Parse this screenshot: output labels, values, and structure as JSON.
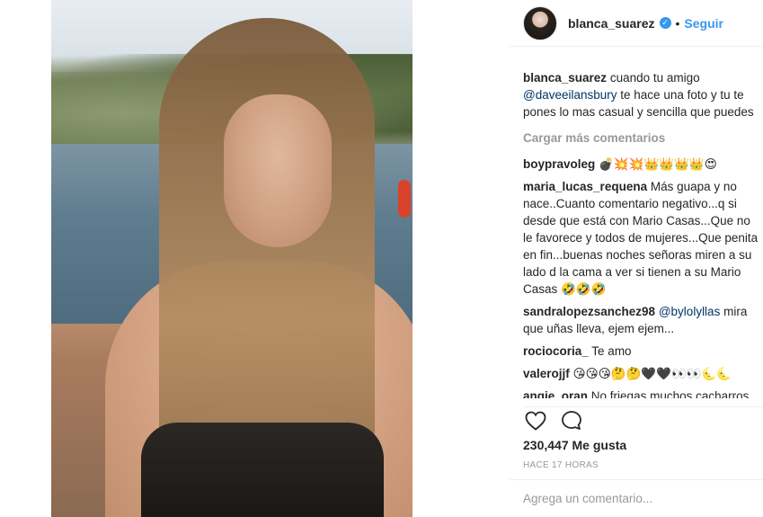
{
  "post": {
    "username": "blanca_suarez",
    "follow_label": "Seguir",
    "separator": "•",
    "verified_glyph": "✓"
  },
  "caption": {
    "username": "blanca_suarez",
    "text_before": "cuando tu amigo",
    "mention": "@daveeilansbury",
    "text_after": "te hace una foto y tu te pones lo mas casual y sencilla que puedes"
  },
  "load_more_label": "Cargar más comentarios",
  "comments": [
    {
      "username": "boypravoleg",
      "text": "💣💥💥👑👑👑👑😍"
    },
    {
      "username": "maria_lucas_requena",
      "text": "Más guapa y no nace..Cuanto comentario negativo...q si desde que está con Mario Casas...Que no le favorece y todos de mujeres...Que penita en fin...buenas noches señoras miren a su lado d la cama a ver si tienen a su Mario Casas 🤣🤣🤣"
    },
    {
      "username": "sandralopezsanchez98",
      "mention": "@bylolyllas",
      "text": "mira que uñas lleva, ejem ejem..."
    },
    {
      "username": "rociocoria_",
      "text": "Te amo"
    },
    {
      "username": "valerojjf",
      "text": "😘😘😘🤔🤔🖤🖤👀👀🌜🌜"
    },
    {
      "username": "angie_oran",
      "text": "No friegas muchos cacharros."
    }
  ],
  "likes_label": "230,447 Me gusta",
  "timestamp": "HACE 17 HORAS",
  "add_comment_placeholder": "Agrega un comentario...",
  "icons": {
    "like": "heart-icon",
    "comment": "comment-icon",
    "verified": "verified-badge-icon"
  },
  "colors": {
    "accent": "#3897f0",
    "mention": "#003569",
    "muted": "#999999"
  }
}
